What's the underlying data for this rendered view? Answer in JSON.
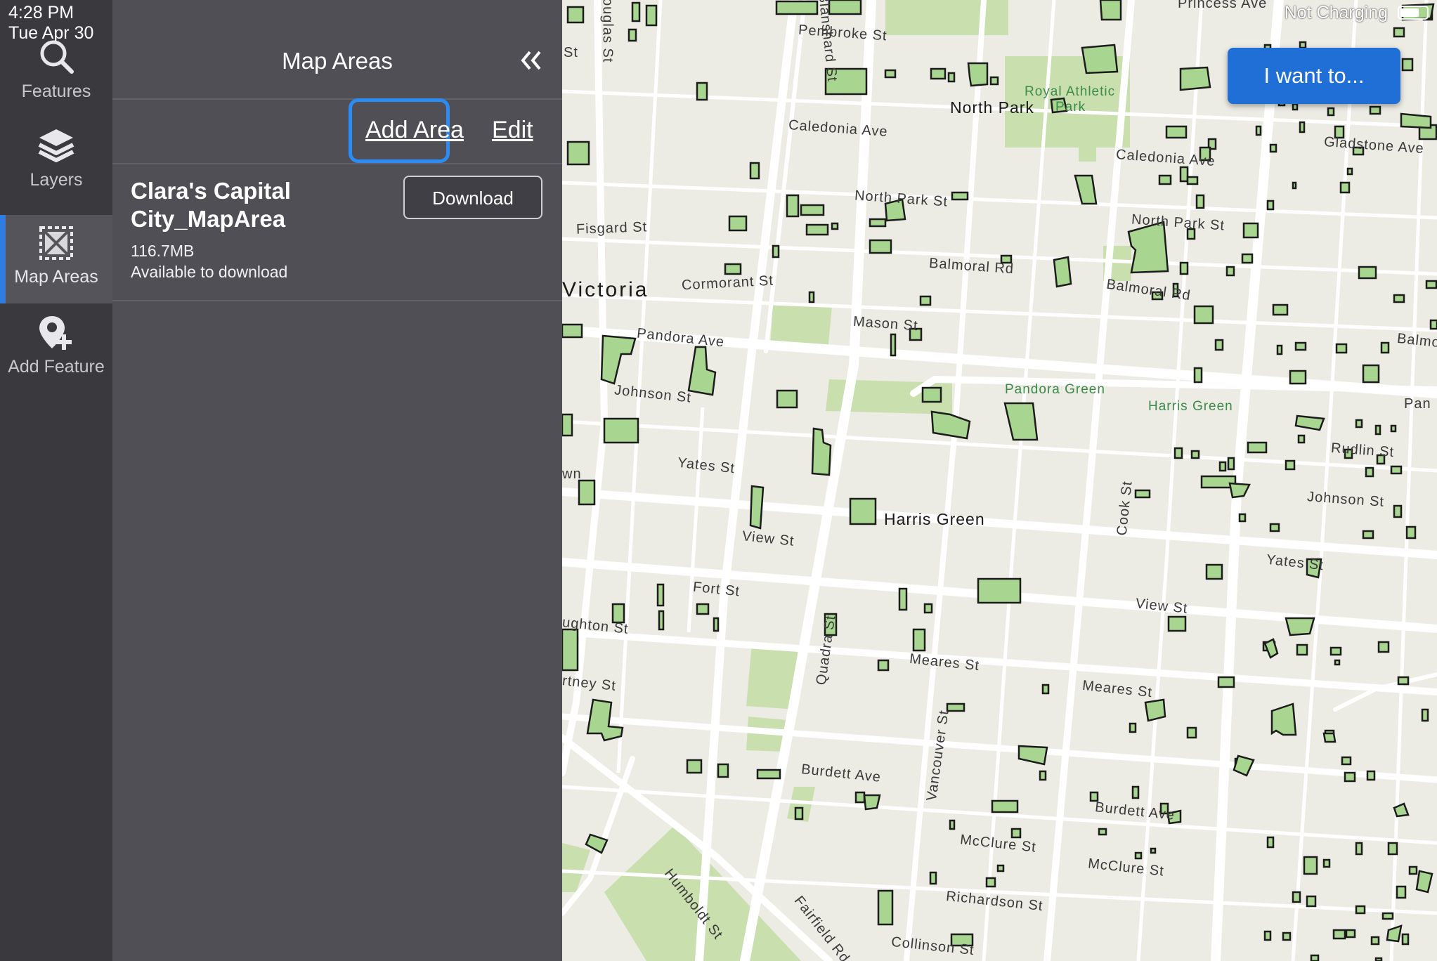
{
  "status_bar": {
    "time": "4:28 PM",
    "date": "Tue Apr 30",
    "charging": "Not Charging"
  },
  "rail": {
    "items": [
      {
        "label": "Features",
        "icon": "search-icon"
      },
      {
        "label": "Layers",
        "icon": "layers-icon"
      },
      {
        "label": "Map Areas",
        "icon": "map-area-icon",
        "active": true
      },
      {
        "label": "Add Feature",
        "icon": "add-feature-icon"
      }
    ]
  },
  "panel": {
    "title": "Map Areas",
    "add_area": "Add Area",
    "edit": "Edit",
    "area": {
      "name": "Clara's Capital City_MapArea",
      "size": "116.7MB",
      "status": "Available to download",
      "download": "Download"
    }
  },
  "map": {
    "i_want_to": "I want to...",
    "labels": [
      "Pembroke St",
      "North Park",
      "Royal Athletic",
      "Park",
      "Caledonia Ave",
      "Caledonia Ave",
      "Gladstone Ave",
      "North Park St",
      "North Park St",
      "Fisgard St",
      "Balmoral Rd",
      "Balmoral Rd",
      "Cormorant St",
      "Victoria",
      "Mason St",
      "Pandora Ave",
      "Pandora Green",
      "Harris Green",
      "Johnson St",
      "Yates St",
      "Harris Green",
      "View St",
      "Cook St",
      "Johnson St",
      "Rudlin St",
      "Yates St",
      "Fort St",
      "View St",
      "Quadra St",
      "Meares St",
      "Meares St",
      "Vancouver St",
      "Burdett Ave",
      "Burdett Ave",
      "McClure St",
      "McClure St",
      "Richardson St",
      "Humboldt St",
      "Fairfield Rd",
      "Collinson St",
      "Balmo",
      "Pan",
      "Princess Ave",
      "Douglas St",
      "Blanshard St",
      "St",
      "ughton St",
      "rtney St",
      "wn"
    ]
  }
}
